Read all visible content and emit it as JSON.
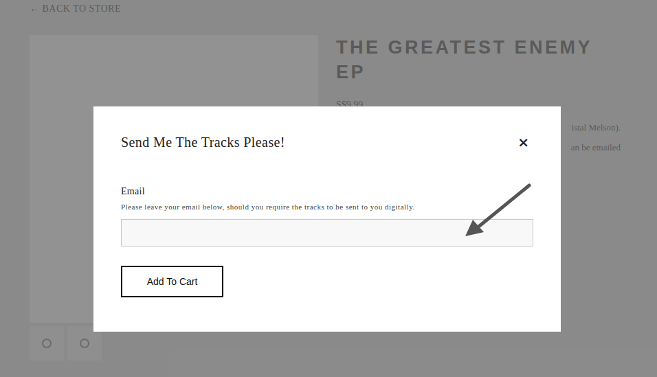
{
  "page": {
    "back_link": "← BACK TO STORE",
    "product_title": "THE GREATEST ENEMY EP",
    "price": "S$9.99",
    "description_fragments": [
      "istal Melson).",
      "an be emailed"
    ]
  },
  "modal": {
    "title": "Send Me The Tracks Please!",
    "close": "×",
    "field": {
      "label": "Email",
      "help": "Please leave your email below, should you require the tracks to be sent to you digitally.",
      "value": ""
    },
    "button": "Add To Cart"
  }
}
